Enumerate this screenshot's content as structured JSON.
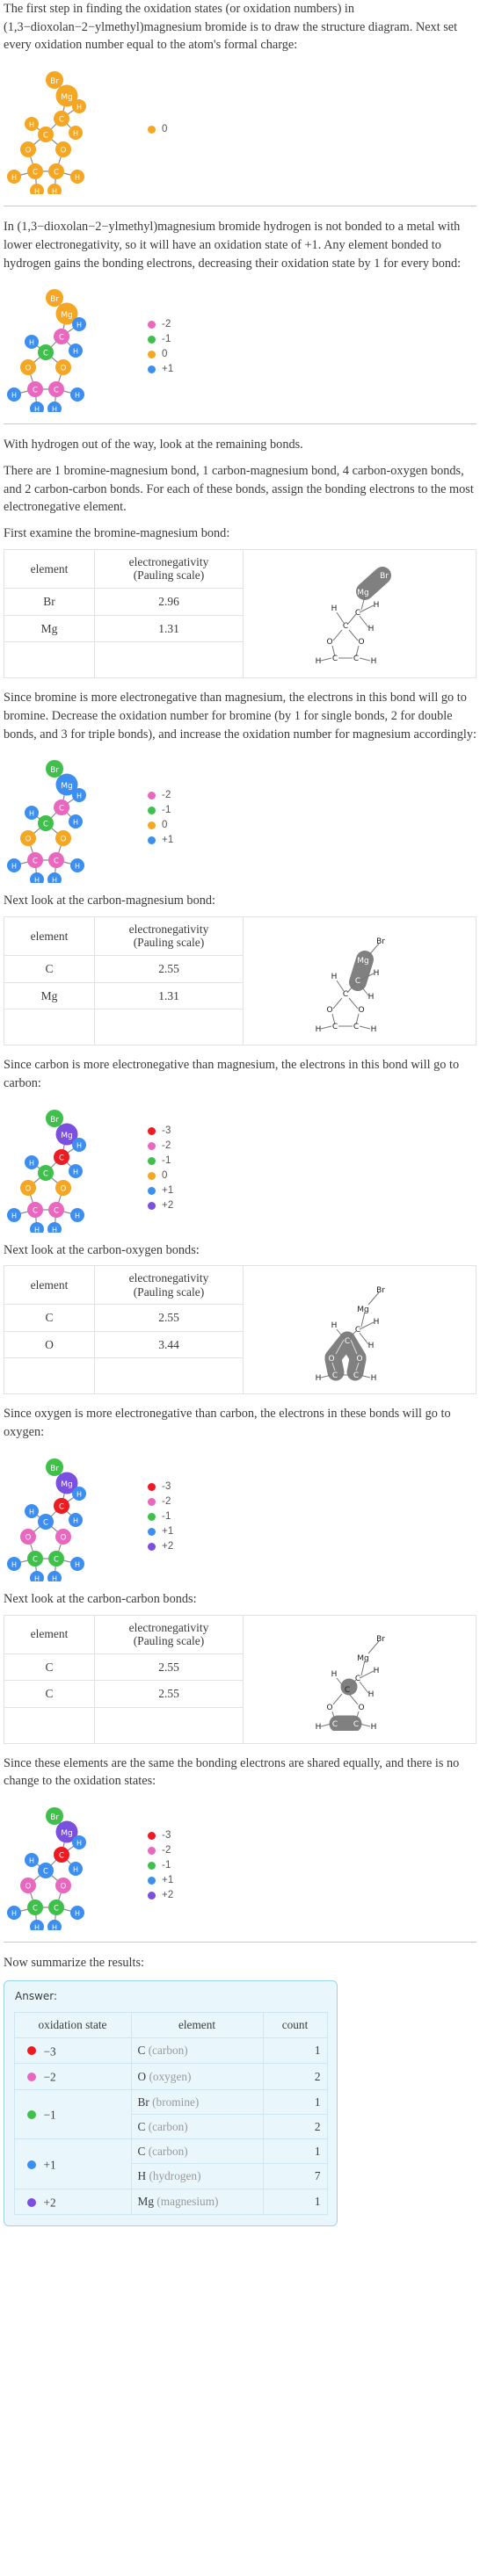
{
  "colors": {
    "orange": "#f5a623",
    "orange_alt": "#ffab20",
    "pink": "#ea67c0",
    "green": "#3fc04b",
    "blue": "#3c8ef0",
    "red": "#ee1b22",
    "purple": "#7b4fe0",
    "bond": "#8a8a8a",
    "highlight": "#808080",
    "rule": "#c9c9c9",
    "answer_border": "#9ed2ea",
    "answer_bg": "#e9f7fd"
  },
  "steps": [
    {
      "id": "step-intro",
      "text": "The first step in finding the oxidation states (or oxidation numbers) in (1,3−dioxolan−2−ylmethyl)magnesium bromide is to draw the structure diagram. Next set every oxidation number equal to the atom's formal charge:",
      "legend": [
        {
          "label": "0",
          "color": "#f5a623"
        }
      ],
      "atom_colors": {
        "Br": "#f5a623",
        "Mg": "#f5a623",
        "C": "#f5a623",
        "O": "#f5a623",
        "H": "#f5a623"
      }
    },
    {
      "id": "step-hydrogen",
      "text": "In (1,3−dioxolan−2−ylmethyl)magnesium bromide hydrogen is not bonded to a metal with lower electronegativity, so it will have an oxidation state of +1. Any element bonded to hydrogen gains the bonding electrons, decreasing their oxidation state by 1 for every bond:",
      "legend": [
        {
          "label": "-2",
          "color": "#ea67c0"
        },
        {
          "label": "-1",
          "color": "#3fc04b"
        },
        {
          "label": "0",
          "color": "#f5a623"
        },
        {
          "label": "+1",
          "color": "#3c8ef0"
        }
      ],
      "atom_colors": {
        "Br": "#f5a623",
        "Mg": "#f5a623",
        "C1": "#ea67c0",
        "C2": "#3fc04b",
        "O": "#f5a623",
        "C4": "#ea67c0",
        "C5": "#ea67c0",
        "H": "#3c8ef0"
      }
    },
    {
      "id": "step-remaining-bonds",
      "text_1": "With hydrogen out of the way, look at the remaining bonds.",
      "text_2": "There are 1 bromine-magnesium bond, 1 carbon-magnesium bond, 4 carbon-oxygen bonds, and 2 carbon-carbon bonds.  For each of these bonds, assign the bonding electrons to the most electronegative element."
    }
  ],
  "bond_sections": [
    {
      "id": "bond-br-mg",
      "intro": "First examine the bromine-magnesium bond:",
      "table": {
        "headers": [
          "element",
          "electronegativity (Pauling scale)"
        ],
        "header_line1": "element",
        "header2_line1": "electronegativity",
        "header2_line2": "(Pauling scale)",
        "rows": [
          {
            "element": "Br",
            "value": "2.96"
          },
          {
            "element": "Mg",
            "value": "1.31"
          }
        ]
      },
      "conclusion": "Since bromine is more electronegative than magnesium, the electrons in this bond will go to bromine. Decrease the oxidation number for bromine (by 1 for single bonds, 2 for double bonds, and 3 for triple bonds), and increase the oxidation number for magnesium accordingly:",
      "legend": [
        {
          "label": "-2",
          "color": "#ea67c0"
        },
        {
          "label": "-1",
          "color": "#3fc04b"
        },
        {
          "label": "0",
          "color": "#f5a623"
        },
        {
          "label": "+1",
          "color": "#3c8ef0"
        }
      ],
      "atom_colors": {
        "Br": "#3fc04b",
        "Mg": "#3c8ef0",
        "C1": "#ea67c0",
        "C2": "#3fc04b",
        "O": "#f5a623",
        "C4": "#ea67c0",
        "C5": "#ea67c0",
        "H": "#3c8ef0"
      },
      "highlight": "br-mg"
    },
    {
      "id": "bond-c-mg",
      "intro": "Next look at the carbon-magnesium bond:",
      "table": {
        "header_line1": "element",
        "header2_line1": "electronegativity",
        "header2_line2": "(Pauling scale)",
        "rows": [
          {
            "element": "C",
            "value": "2.55"
          },
          {
            "element": "Mg",
            "value": "1.31"
          }
        ]
      },
      "conclusion": "Since carbon is more electronegative than magnesium, the electrons in this bond will go to carbon:",
      "legend": [
        {
          "label": "-3",
          "color": "#ee1b22"
        },
        {
          "label": "-2",
          "color": "#ea67c0"
        },
        {
          "label": "-1",
          "color": "#3fc04b"
        },
        {
          "label": "0",
          "color": "#f5a623"
        },
        {
          "label": "+1",
          "color": "#3c8ef0"
        },
        {
          "label": "+2",
          "color": "#7b4fe0"
        }
      ],
      "atom_colors": {
        "Br": "#3fc04b",
        "Mg": "#7b4fe0",
        "C1": "#ee1b22",
        "C2": "#3fc04b",
        "O": "#f5a623",
        "C4": "#ea67c0",
        "C5": "#ea67c0",
        "H": "#3c8ef0"
      },
      "highlight": "c-mg"
    },
    {
      "id": "bond-c-o",
      "intro": "Next look at the carbon-oxygen bonds:",
      "table": {
        "header_line1": "element",
        "header2_line1": "electronegativity",
        "header2_line2": "(Pauling scale)",
        "rows": [
          {
            "element": "C",
            "value": "2.55"
          },
          {
            "element": "O",
            "value": "3.44"
          }
        ]
      },
      "conclusion": "Since oxygen is more electronegative than carbon, the electrons in these bonds will go to oxygen:",
      "legend": [
        {
          "label": "-3",
          "color": "#ee1b22"
        },
        {
          "label": "-2",
          "color": "#ea67c0"
        },
        {
          "label": "-1",
          "color": "#3fc04b"
        },
        {
          "label": "+1",
          "color": "#3c8ef0"
        },
        {
          "label": "+2",
          "color": "#7b4fe0"
        }
      ],
      "atom_colors": {
        "Br": "#3fc04b",
        "Mg": "#7b4fe0",
        "C1": "#ee1b22",
        "C2": "#3c8ef0",
        "O": "#ea67c0",
        "C4": "#3fc04b",
        "C5": "#3fc04b",
        "H": "#3c8ef0"
      },
      "highlight": "c-o"
    },
    {
      "id": "bond-c-c",
      "intro": "Next look at the carbon-carbon bonds:",
      "table": {
        "header_line1": "element",
        "header2_line1": "electronegativity",
        "header2_line2": "(Pauling scale)",
        "rows": [
          {
            "element": "C",
            "value": "2.55"
          },
          {
            "element": "C",
            "value": "2.55"
          }
        ]
      },
      "conclusion": "Since these elements are the same the bonding electrons are shared equally, and there is no change to the oxidation states:",
      "legend": [
        {
          "label": "-3",
          "color": "#ee1b22"
        },
        {
          "label": "-2",
          "color": "#ea67c0"
        },
        {
          "label": "-1",
          "color": "#3fc04b"
        },
        {
          "label": "+1",
          "color": "#3c8ef0"
        },
        {
          "label": "+2",
          "color": "#7b4fe0"
        }
      ],
      "atom_colors": {
        "Br": "#3fc04b",
        "Mg": "#7b4fe0",
        "C1": "#ee1b22",
        "C2": "#3c8ef0",
        "O": "#ea67c0",
        "C4": "#3fc04b",
        "C5": "#3fc04b",
        "H": "#3c8ef0"
      },
      "highlight": "c-c"
    }
  ],
  "summary": {
    "intro": "Now summarize the results:",
    "answer_label": "Answer:",
    "headers": {
      "oxidation_state": "oxidation state",
      "element": "element",
      "count": "count"
    },
    "rows": [
      {
        "state": "−3",
        "color": "#ee1b22",
        "element_symbol": "C",
        "element_name": "(carbon)",
        "count": "1",
        "first": true
      },
      {
        "state": "−2",
        "color": "#ea67c0",
        "element_symbol": "O",
        "element_name": "(oxygen)",
        "count": "2",
        "first": true
      },
      {
        "state": "−1",
        "color": "#3fc04b",
        "element_symbol": "Br",
        "element_name": "(bromine)",
        "count": "1",
        "first": true
      },
      {
        "state": "",
        "color": "",
        "element_symbol": "C",
        "element_name": "(carbon)",
        "count": "2",
        "first": false
      },
      {
        "state": "+1",
        "color": "#3c8ef0",
        "element_symbol": "C",
        "element_name": "(carbon)",
        "count": "1",
        "first": true
      },
      {
        "state": "",
        "color": "",
        "element_symbol": "H",
        "element_name": "(hydrogen)",
        "count": "7",
        "first": false
      },
      {
        "state": "+2",
        "color": "#7b4fe0",
        "element_symbol": "Mg",
        "element_name": "(magnesium)",
        "count": "1",
        "first": true
      }
    ]
  },
  "molecule": {
    "atoms": [
      "Br",
      "Mg",
      "C",
      "H",
      "H",
      "C",
      "H",
      "O",
      "O",
      "C",
      "C",
      "H",
      "H",
      "H",
      "H"
    ],
    "formula_name": "(1,3−dioxolan−2−ylmethyl)magnesium bromide"
  }
}
